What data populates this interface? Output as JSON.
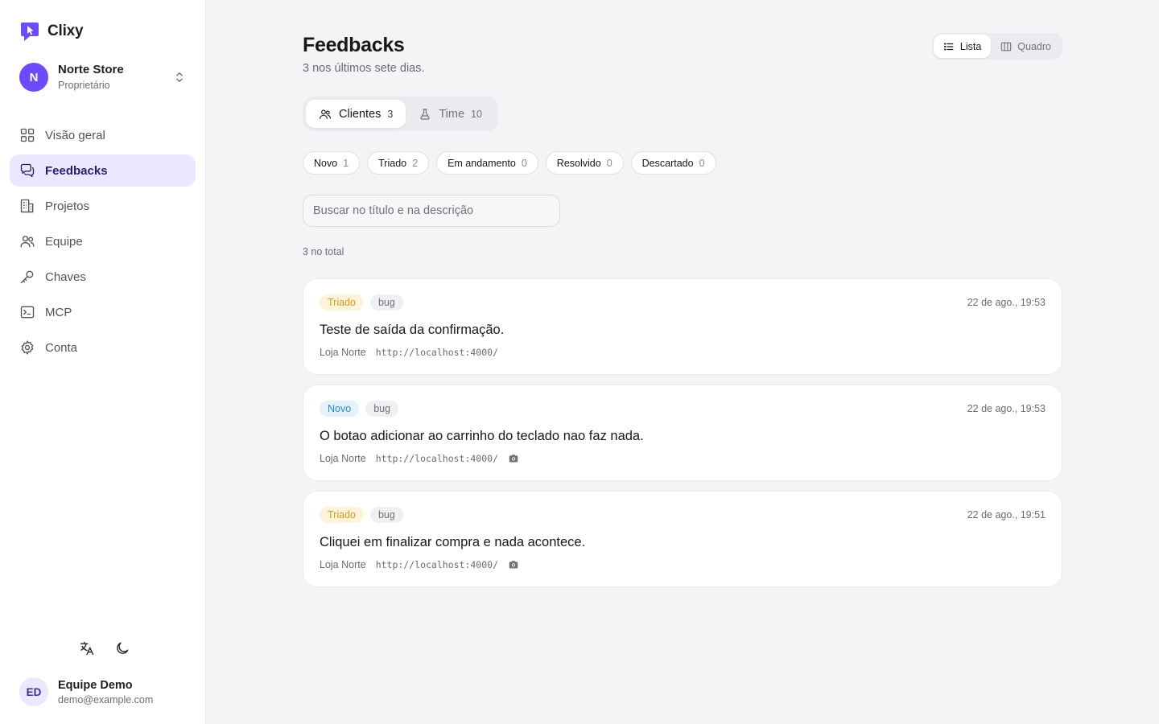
{
  "app": {
    "name": "Clixy",
    "accent": "#6d4aff"
  },
  "org": {
    "initial": "N",
    "name": "Norte Store",
    "role": "Proprietário"
  },
  "nav": {
    "items": [
      {
        "label": "Visão geral",
        "icon": "grid-icon"
      },
      {
        "label": "Feedbacks",
        "icon": "chat-bubbles-icon",
        "active": true
      },
      {
        "label": "Projetos",
        "icon": "building-icon"
      },
      {
        "label": "Equipe",
        "icon": "users-icon"
      },
      {
        "label": "Chaves",
        "icon": "key-icon"
      },
      {
        "label": "MCP",
        "icon": "terminal-icon"
      },
      {
        "label": "Conta",
        "icon": "gear-icon"
      }
    ]
  },
  "prefs": {
    "language_icon": "translate-icon",
    "theme_icon": "moon-icon"
  },
  "user": {
    "initials": "ED",
    "name": "Equipe Demo",
    "email": "demo@example.com"
  },
  "page": {
    "title": "Feedbacks",
    "subtitle": "3 nos últimos sete dias."
  },
  "view_toggle": {
    "list_label": "Lista",
    "board_label": "Quadro",
    "selected": "Lista"
  },
  "segments": [
    {
      "label": "Clientes",
      "count": "3",
      "icon": "users-icon",
      "active": true
    },
    {
      "label": "Time",
      "count": "10",
      "icon": "flask-icon"
    }
  ],
  "filters": [
    {
      "label": "Novo",
      "count": "1"
    },
    {
      "label": "Triado",
      "count": "2"
    },
    {
      "label": "Em andamento",
      "count": "0"
    },
    {
      "label": "Resolvido",
      "count": "0"
    },
    {
      "label": "Descartado",
      "count": "0"
    }
  ],
  "search": {
    "placeholder": "Buscar no título e na descrição",
    "value": ""
  },
  "total": "3 no total",
  "feedbacks": [
    {
      "status": "Triado",
      "label": "bug",
      "date": "22 de ago., 19:53",
      "title": "Teste de saída da confirmação.",
      "store": "Loja Norte",
      "url": "http://localhost:4000/",
      "has_screenshot": false
    },
    {
      "status": "Novo",
      "label": "bug",
      "date": "22 de ago., 19:53",
      "title": "O botao adicionar ao carrinho do teclado nao faz nada.",
      "store": "Loja Norte",
      "url": "http://localhost:4000/",
      "has_screenshot": true
    },
    {
      "status": "Triado",
      "label": "bug",
      "date": "22 de ago., 19:51",
      "title": "Cliquei em finalizar compra e nada acontece.",
      "store": "Loja Norte",
      "url": "http://localhost:4000/",
      "has_screenshot": true
    }
  ]
}
